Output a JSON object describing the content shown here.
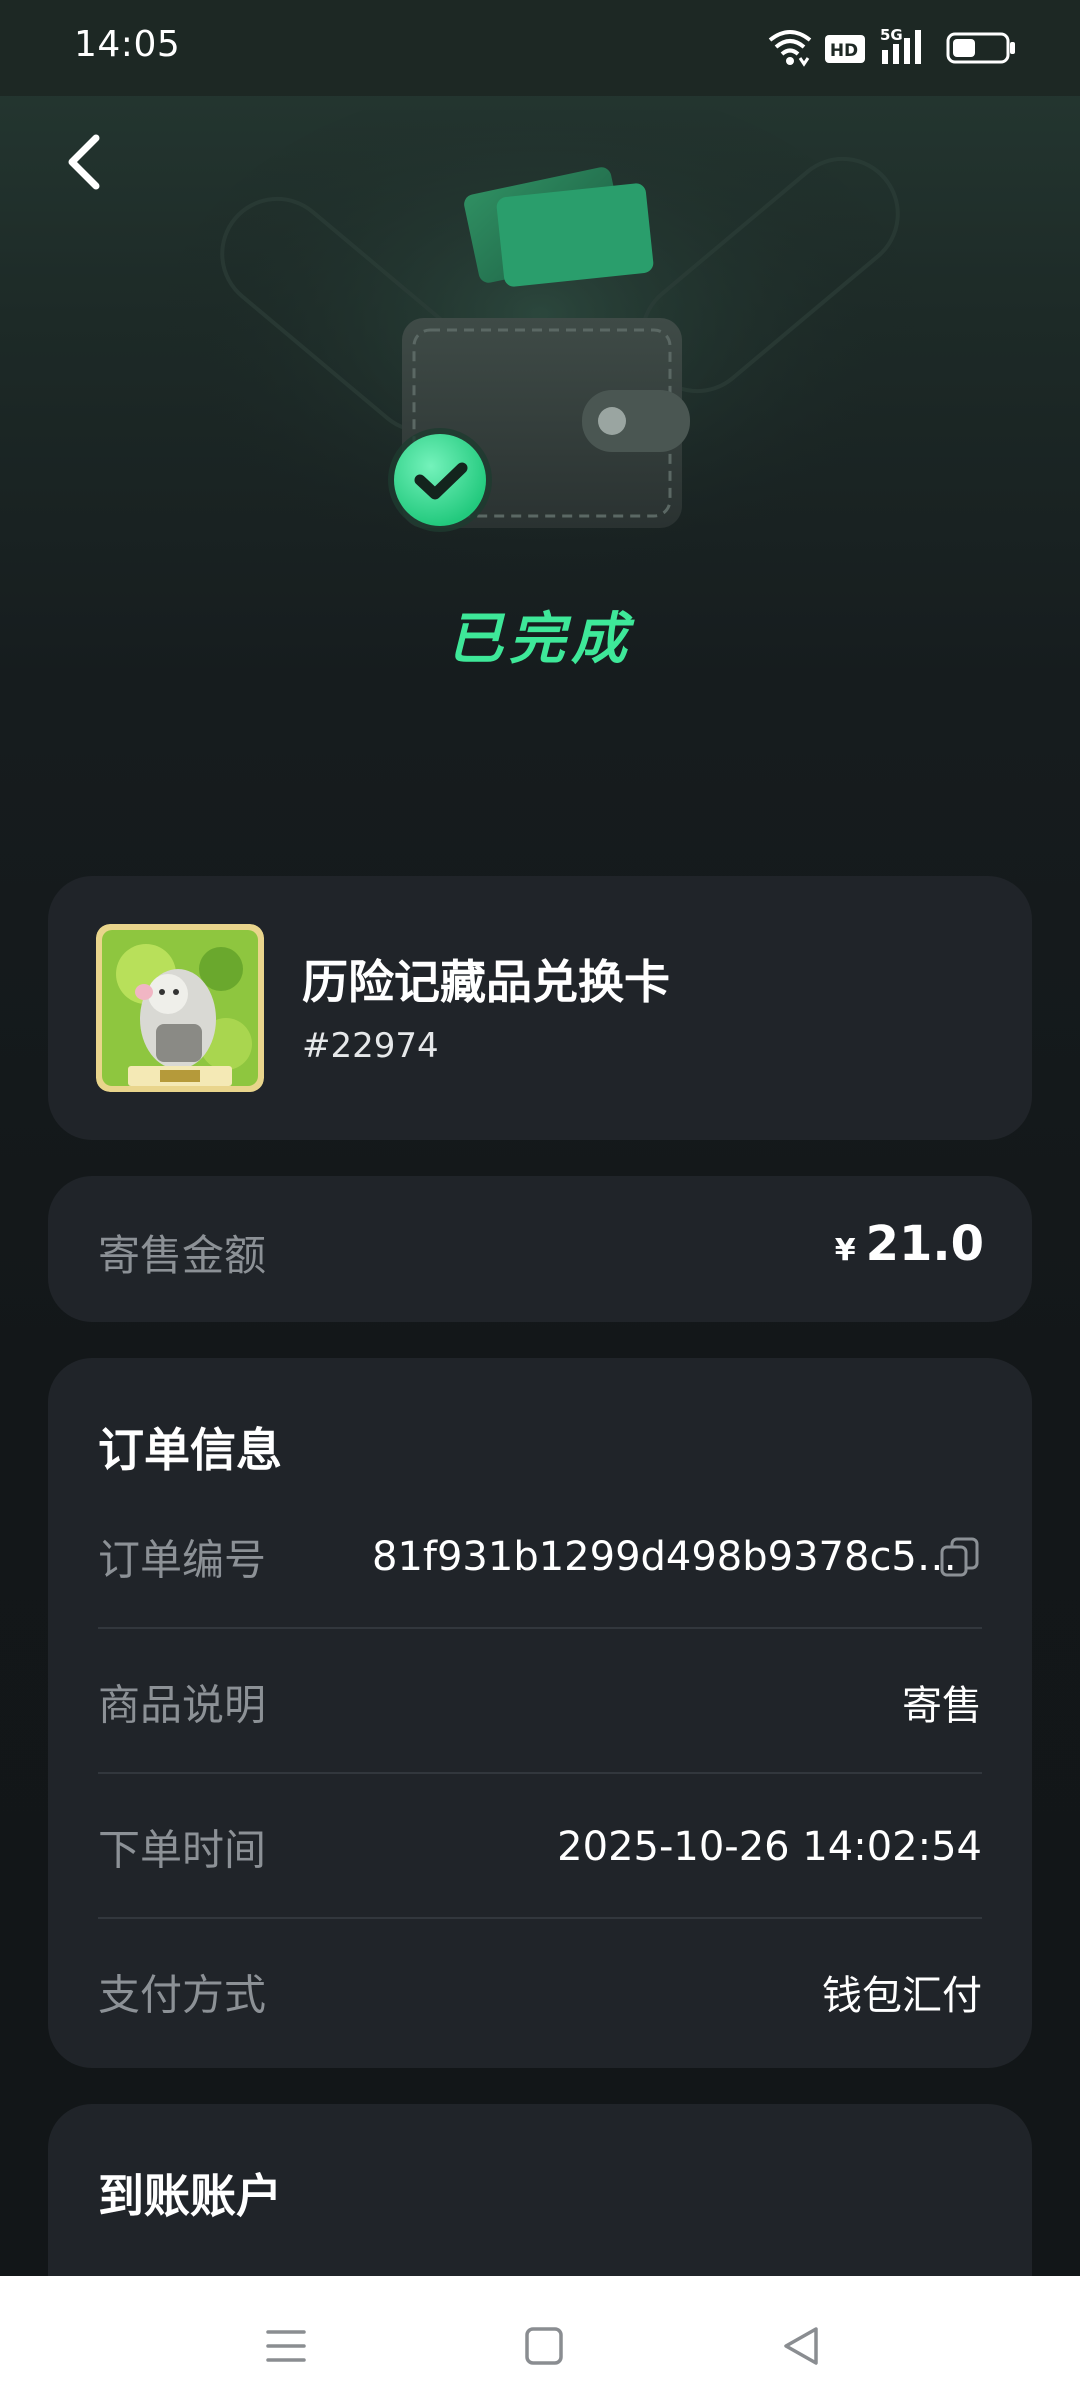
{
  "status_bar": {
    "time": "14:05",
    "hd_label": "HD",
    "network_label": "5G",
    "icons": [
      "wifi-icon",
      "hd-icon",
      "signal-icon",
      "battery-icon"
    ]
  },
  "hero": {
    "status_text": "已完成",
    "accent_color": "#3ee899"
  },
  "product": {
    "name": "历险记藏品兑换卡",
    "id": "#22974"
  },
  "amount": {
    "label": "寄售金额",
    "currency": "¥",
    "value": "21.0"
  },
  "order_info": {
    "title": "订单信息",
    "rows": [
      {
        "label": "订单编号",
        "value": "81f931b1299d498b9378c5c..."
      },
      {
        "label": "商品说明",
        "value": "寄售"
      },
      {
        "label": "下单时间",
        "value": "2025-10-26 14:02:54"
      },
      {
        "label": "支付方式",
        "value": "钱包汇付"
      }
    ]
  },
  "account": {
    "title": "到账账户"
  }
}
